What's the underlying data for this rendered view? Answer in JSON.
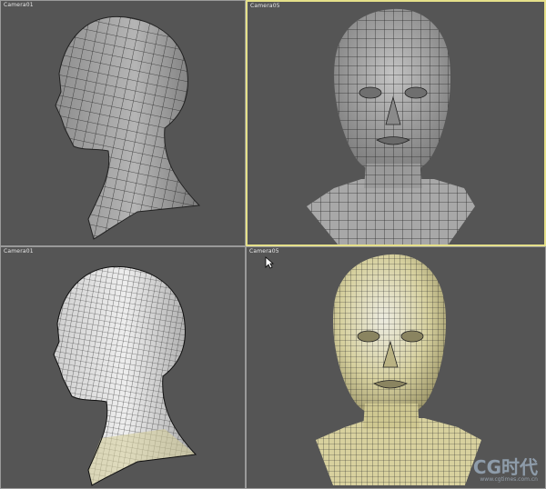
{
  "viewports": [
    {
      "label": "Camera01",
      "model": "Head mesh, left profile, coarse gray polygons"
    },
    {
      "label": "Camera05",
      "model": "Head mesh, front view, coarse gray polygons with shoulders"
    },
    {
      "label": "Camera01",
      "model": "Head mesh, left profile, dense white wireframe"
    },
    {
      "label": "Camera05",
      "model": "Head mesh, front view, dense yellowish wireframe"
    }
  ],
  "watermark": {
    "logo": "CG时代",
    "url": "www.cgtimes.com.cn"
  },
  "colors": {
    "viewport_bg": "#555555",
    "active_border": "#e5e08a",
    "mesh_gray": "#a9a9a9",
    "mesh_white": "#e6e6e6",
    "mesh_yellow": "#d9d2a0"
  },
  "icons": {
    "cursor": "mouse-pointer-icon"
  }
}
